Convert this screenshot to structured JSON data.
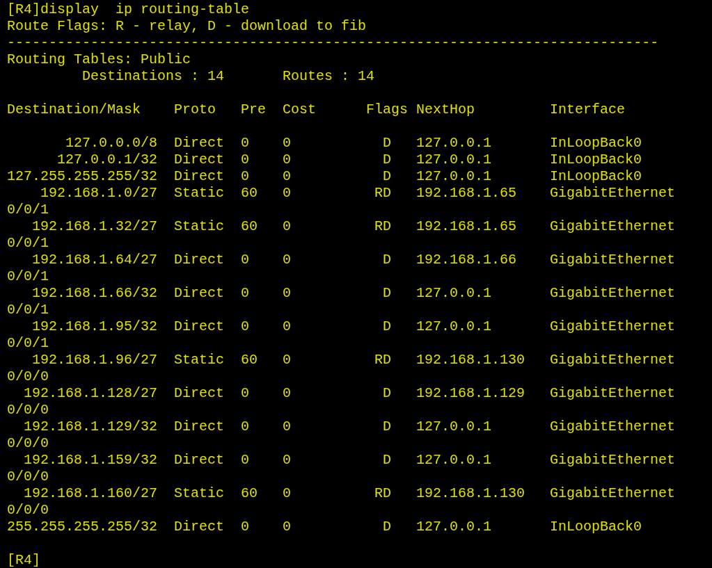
{
  "command": "[R4]display  ip routing-table",
  "flags_legend": "Route Flags: R - relay, D - download to fib",
  "separator": "------------------------------------------------------------------------------",
  "table_name": "Routing Tables: Public",
  "summary": {
    "destinations_label": "Destinations : 14",
    "routes_label": "Routes : 14"
  },
  "columns": [
    "Destination/Mask",
    "Proto",
    "Pre",
    "Cost",
    "Flags",
    "NextHop",
    "Interface"
  ],
  "rows": [
    {
      "destination": "127.0.0.0/8",
      "proto": "Direct",
      "pre": "0",
      "cost": "0",
      "flags": "D",
      "nexthop": "127.0.0.1",
      "interface": "InLoopBack0"
    },
    {
      "destination": "127.0.0.1/32",
      "proto": "Direct",
      "pre": "0",
      "cost": "0",
      "flags": "D",
      "nexthop": "127.0.0.1",
      "interface": "InLoopBack0"
    },
    {
      "destination": "127.255.255.255/32",
      "proto": "Direct",
      "pre": "0",
      "cost": "0",
      "flags": "D",
      "nexthop": "127.0.0.1",
      "interface": "InLoopBack0"
    },
    {
      "destination": "192.168.1.0/27",
      "proto": "Static",
      "pre": "60",
      "cost": "0",
      "flags": "RD",
      "nexthop": "192.168.1.65",
      "interface": "GigabitEthernet",
      "interface_continued": "0/0/1"
    },
    {
      "destination": "192.168.1.32/27",
      "proto": "Static",
      "pre": "60",
      "cost": "0",
      "flags": "RD",
      "nexthop": "192.168.1.65",
      "interface": "GigabitEthernet",
      "interface_continued": "0/0/1"
    },
    {
      "destination": "192.168.1.64/27",
      "proto": "Direct",
      "pre": "0",
      "cost": "0",
      "flags": "D",
      "nexthop": "192.168.1.66",
      "interface": "GigabitEthernet",
      "interface_continued": "0/0/1"
    },
    {
      "destination": "192.168.1.66/32",
      "proto": "Direct",
      "pre": "0",
      "cost": "0",
      "flags": "D",
      "nexthop": "127.0.0.1",
      "interface": "GigabitEthernet",
      "interface_continued": "0/0/1"
    },
    {
      "destination": "192.168.1.95/32",
      "proto": "Direct",
      "pre": "0",
      "cost": "0",
      "flags": "D",
      "nexthop": "127.0.0.1",
      "interface": "GigabitEthernet",
      "interface_continued": "0/0/1"
    },
    {
      "destination": "192.168.1.96/27",
      "proto": "Static",
      "pre": "60",
      "cost": "0",
      "flags": "RD",
      "nexthop": "192.168.1.130",
      "interface": "GigabitEthernet",
      "interface_continued": "0/0/0"
    },
    {
      "destination": "192.168.1.128/27",
      "proto": "Direct",
      "pre": "0",
      "cost": "0",
      "flags": "D",
      "nexthop": "192.168.1.129",
      "interface": "GigabitEthernet",
      "interface_continued": "0/0/0"
    },
    {
      "destination": "192.168.1.129/32",
      "proto": "Direct",
      "pre": "0",
      "cost": "0",
      "flags": "D",
      "nexthop": "127.0.0.1",
      "interface": "GigabitEthernet",
      "interface_continued": "0/0/0"
    },
    {
      "destination": "192.168.1.159/32",
      "proto": "Direct",
      "pre": "0",
      "cost": "0",
      "flags": "D",
      "nexthop": "127.0.0.1",
      "interface": "GigabitEthernet",
      "interface_continued": "0/0/0"
    },
    {
      "destination": "192.168.1.160/27",
      "proto": "Static",
      "pre": "60",
      "cost": "0",
      "flags": "RD",
      "nexthop": "192.168.1.130",
      "interface": "GigabitEthernet",
      "interface_continued": "0/0/0"
    },
    {
      "destination": "255.255.255.255/32",
      "proto": "Direct",
      "pre": "0",
      "cost": "0",
      "flags": "D",
      "nexthop": "127.0.0.1",
      "interface": "InLoopBack0"
    }
  ],
  "prompt": "[R4]"
}
